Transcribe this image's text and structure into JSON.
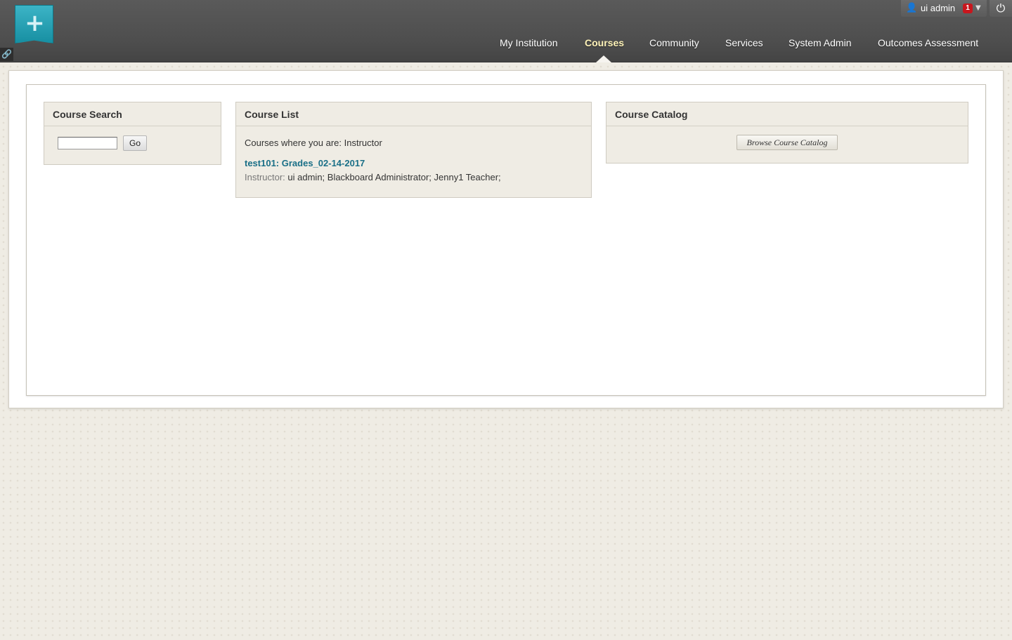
{
  "header": {
    "logo_symbol": "+",
    "user": {
      "name": "ui admin",
      "notification_count": "1"
    },
    "nav": [
      {
        "label": "My Institution",
        "active": false
      },
      {
        "label": "Courses",
        "active": true
      },
      {
        "label": "Community",
        "active": false
      },
      {
        "label": "Services",
        "active": false
      },
      {
        "label": "System Admin",
        "active": false
      },
      {
        "label": "Outcomes Assessment",
        "active": false
      }
    ]
  },
  "modules": {
    "course_search": {
      "title": "Course Search",
      "input_value": "",
      "go_label": "Go"
    },
    "course_list": {
      "title": "Course List",
      "role_line": "Courses where you are: Instructor",
      "courses": [
        {
          "link": "test101: Grades_02-14-2017",
          "instructor_label": "Instructor:",
          "instructors": " ui admin;  Blackboard Administrator;  Jenny1 Teacher;"
        }
      ]
    },
    "course_catalog": {
      "title": "Course Catalog",
      "browse_label": "Browse Course Catalog"
    }
  },
  "colors": {
    "header_bg": "#4d4d4d",
    "active_nav": "#fff3b8",
    "link": "#1a6f87",
    "notification_badge": "#c8161d",
    "logo_teal": "#178fa2"
  },
  "icons": [
    "plus-icon",
    "link-icon",
    "user-icon",
    "caret-down-icon",
    "power-icon"
  ]
}
